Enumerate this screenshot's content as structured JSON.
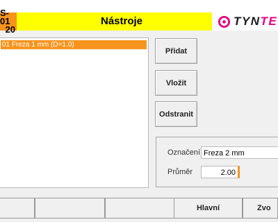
{
  "header": {
    "code_line1": "S-01",
    "code_line2": "20",
    "title": "Nástroje",
    "brand_prefix": "TYN",
    "brand_suffix": "TE"
  },
  "tool_list": {
    "items": [
      {
        "label": "01 Freza 1 mm (D=1.0)",
        "selected": true
      }
    ]
  },
  "actions": {
    "add": "Přidat",
    "insert": "Vložit",
    "remove": "Odstranit"
  },
  "details": {
    "name_label": "Označení",
    "name_value": "Freza 2 mm",
    "diameter_label": "Průměr",
    "diameter_value": "2.00"
  },
  "footer": {
    "buttons": [
      "",
      "",
      "",
      "",
      "Hlavní",
      "Zvo"
    ]
  },
  "colors": {
    "accent_orange": "#f7941d",
    "header_yellow": "#ffff00",
    "brand_magenta": "#e5007e"
  }
}
